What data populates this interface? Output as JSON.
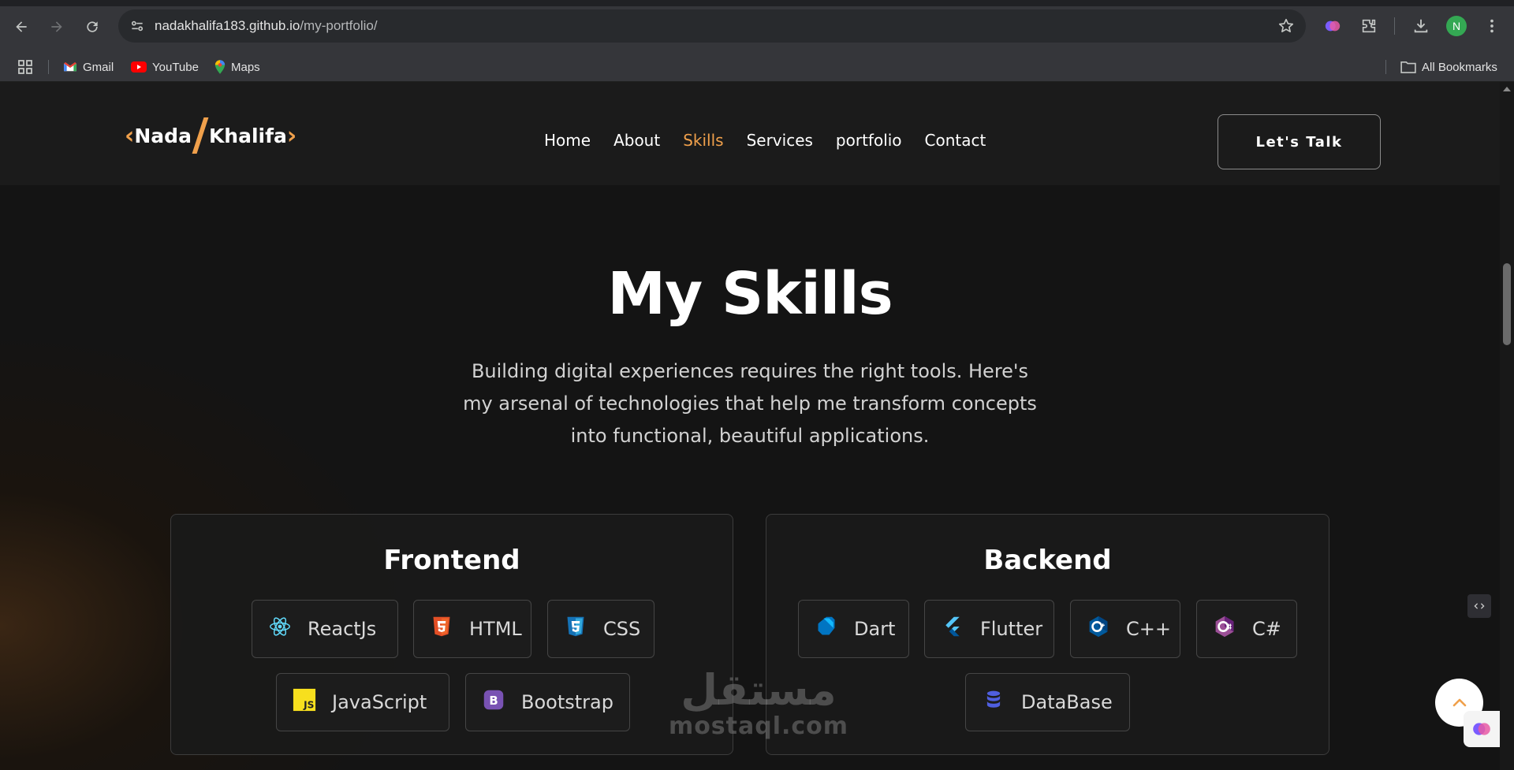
{
  "browser": {
    "url_host": "nadakhalifa183.github.io",
    "url_path": "/my-portfolio/",
    "profile_initial": "N",
    "bookmarks": [
      {
        "label": "Gmail",
        "icon": "gmail-icon"
      },
      {
        "label": "YouTube",
        "icon": "youtube-icon"
      },
      {
        "label": "Maps",
        "icon": "maps-icon"
      }
    ],
    "all_bookmarks_label": "All Bookmarks"
  },
  "header": {
    "logo_first": "Nada",
    "logo_last": "Khalifa",
    "nav": [
      {
        "label": "Home",
        "active": false
      },
      {
        "label": "About",
        "active": false
      },
      {
        "label": "Skills",
        "active": true
      },
      {
        "label": "Services",
        "active": false
      },
      {
        "label": "portfolio",
        "active": false
      },
      {
        "label": "Contact",
        "active": false
      }
    ],
    "cta_label": "Let's Talk",
    "accent_color": "#f0a04b"
  },
  "skills": {
    "title": "My Skills",
    "subtitle": "Building digital experiences requires the right tools. Here's my arsenal of technologies that help me transform concepts into functional, beautiful applications.",
    "frontend": {
      "title": "Frontend",
      "items": [
        {
          "label": "ReactJs",
          "icon": "react-icon"
        },
        {
          "label": "HTML",
          "icon": "html5-icon"
        },
        {
          "label": "CSS",
          "icon": "css3-icon"
        },
        {
          "label": "JavaScript",
          "icon": "javascript-icon"
        },
        {
          "label": "Bootstrap",
          "icon": "bootstrap-icon"
        }
      ]
    },
    "backend": {
      "title": "Backend",
      "items": [
        {
          "label": "Dart",
          "icon": "dart-icon"
        },
        {
          "label": "Flutter",
          "icon": "flutter-icon"
        },
        {
          "label": "C++",
          "icon": "cplusplus-icon"
        },
        {
          "label": "C#",
          "icon": "csharp-icon"
        },
        {
          "label": "DataBase",
          "icon": "database-icon"
        }
      ]
    }
  },
  "watermark": {
    "arabic": "مستقل",
    "latin": "mostaql.com"
  }
}
